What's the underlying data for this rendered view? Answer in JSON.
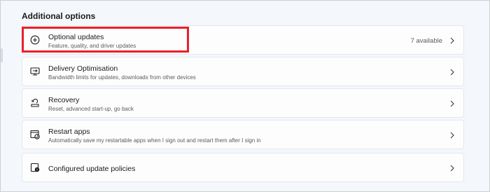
{
  "section": {
    "title": "Additional options"
  },
  "options": [
    {
      "title": "Optional updates",
      "description": "Feature, quality, and driver updates",
      "status": "7 available",
      "icon": "plus-circle-icon"
    },
    {
      "title": "Delivery Optimisation",
      "description": "Bandwidth limits for updates, downloads from other devices",
      "icon": "delivery-optimisation-icon"
    },
    {
      "title": "Recovery",
      "description": "Reset, advanced start-up, go back",
      "icon": "recovery-icon"
    },
    {
      "title": "Restart apps",
      "description": "Automatically save my restartable apps when I sign out and restart them after I sign in",
      "icon": "restart-apps-icon"
    },
    {
      "title": "Configured update policies",
      "icon": "policy-icon"
    }
  ],
  "colors": {
    "highlight": "#e8202a",
    "card_background": "#fdfdfd",
    "page_background": "#f4f7fb"
  }
}
